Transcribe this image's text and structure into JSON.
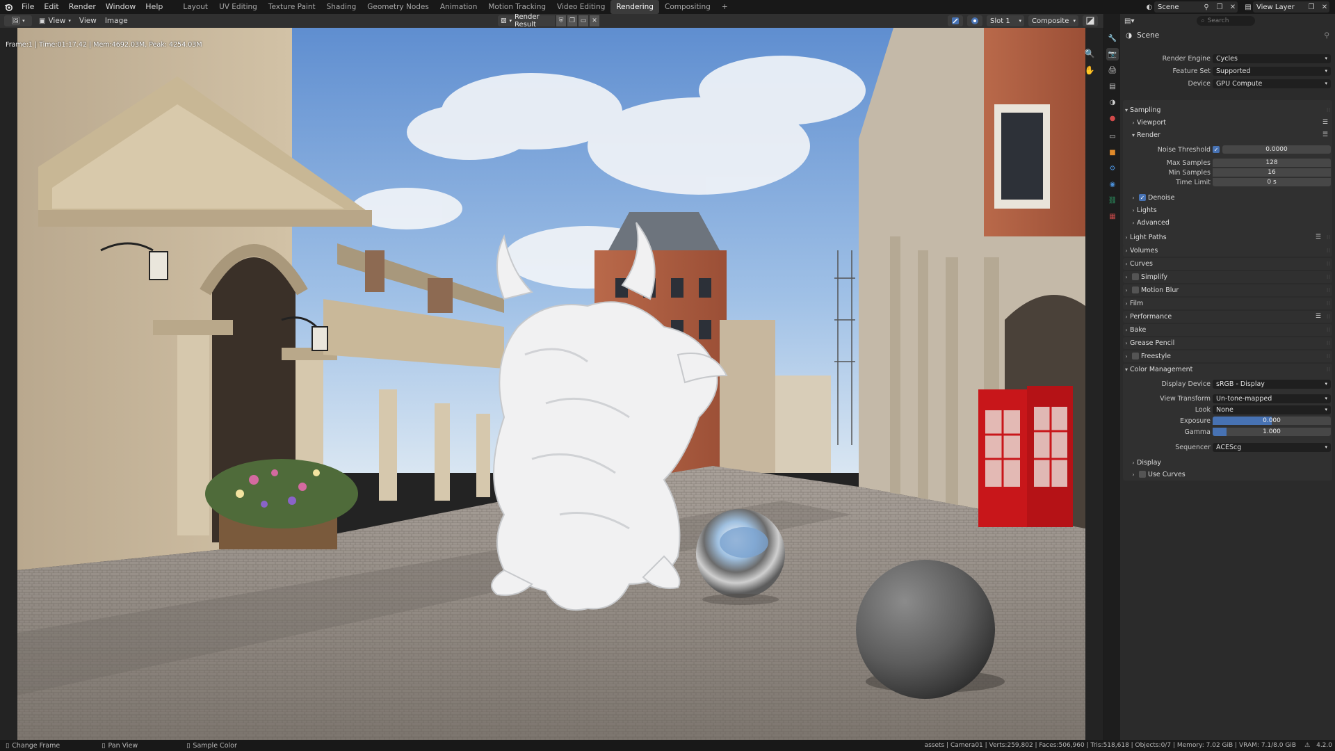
{
  "topbar": {
    "menu": [
      "File",
      "Edit",
      "Render",
      "Window",
      "Help"
    ],
    "workspaces": [
      "Layout",
      "UV Editing",
      "Texture Paint",
      "Shading",
      "Geometry Nodes",
      "Animation",
      "Motion Tracking",
      "Video Editing",
      "Rendering",
      "Compositing",
      "+"
    ],
    "active_workspace": "Rendering",
    "scene": "Scene",
    "view_layer": "View Layer"
  },
  "image_header": {
    "menu": [
      "View",
      "View",
      "Image"
    ],
    "image_name": "Render Result",
    "slot": "Slot 1",
    "pass": "Composite"
  },
  "viewport": {
    "frame_info": "Frame:1 | Time:01:17.42 | Mem:4692.03M, Peak: 4254.03M"
  },
  "properties": {
    "search_placeholder": "Search",
    "scene_label": "Scene",
    "render_engine_label": "Render Engine",
    "render_engine": "Cycles",
    "feature_set_label": "Feature Set",
    "feature_set": "Supported",
    "device_label": "Device",
    "device": "GPU Compute",
    "sampling": "Sampling",
    "viewport": "Viewport",
    "render": "Render",
    "noise_threshold_label": "Noise Threshold",
    "noise_threshold": "0.0000",
    "max_samples_label": "Max Samples",
    "max_samples": "128",
    "min_samples_label": "Min Samples",
    "min_samples": "16",
    "time_limit_label": "Time Limit",
    "time_limit": "0 s",
    "denoise": "Denoise",
    "lights": "Lights",
    "advanced": "Advanced",
    "sections": [
      "Light Paths",
      "Volumes",
      "Curves",
      "Simplify",
      "Motion Blur",
      "Film",
      "Performance",
      "Bake",
      "Grease Pencil",
      "Freestyle"
    ],
    "color_management": "Color Management",
    "display_device_label": "Display Device",
    "display_device": "sRGB - Display",
    "view_transform_label": "View Transform",
    "view_transform": "Un-tone-mapped",
    "look_label": "Look",
    "look": "None",
    "exposure_label": "Exposure",
    "exposure": "0.000",
    "gamma_label": "Gamma",
    "gamma": "1.000",
    "sequencer_label": "Sequencer",
    "sequencer": "ACEScg",
    "display": "Display",
    "use_curves": "Use Curves"
  },
  "statusbar": {
    "hint1": "Change Frame",
    "hint2": "Pan View",
    "hint3": "Sample Color",
    "stats": "assets | Camera01 | Verts:259,802 | Faces:506,960 | Tris:518,618 | Objects:0/7 | Memory: 7.02 GiB | VRAM: 7.1/8.0 GiB",
    "version": "4.2.0"
  },
  "colors": {
    "accent": "#4772b3",
    "phone_box": "#c8161a",
    "sky": "#6f9fd6"
  }
}
